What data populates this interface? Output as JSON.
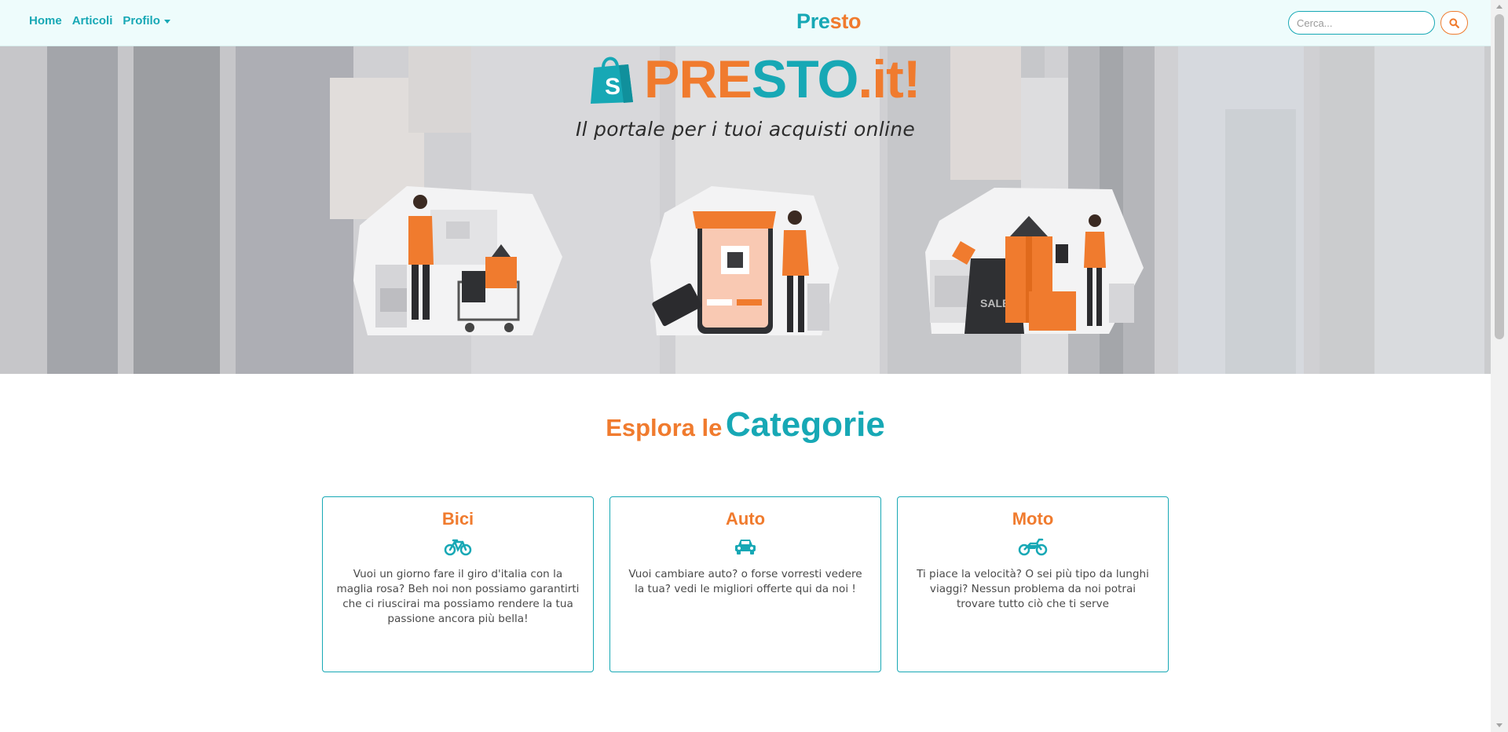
{
  "navbar": {
    "links": [
      "Home",
      "Articoli",
      "Profilo"
    ],
    "brand_part1": "Pre",
    "brand_part2": "sto",
    "search_placeholder": "Cerca..."
  },
  "hero": {
    "logo_part1": "PRE",
    "logo_part2": "STO",
    "logo_part3": ".it!",
    "logo_icon": "shopping-bag-icon",
    "subtitle": "Il portale per i tuoi acquisti online"
  },
  "categories": {
    "title_small": "Esplora le",
    "title_big": "Categorie",
    "cards": [
      {
        "title": "Bici",
        "icon": "bicycle-icon",
        "text": "Vuoi un giorno fare il giro d'italia con la maglia rosa? Beh noi non possiamo garantirti che ci riuscirai ma possiamo rendere la tua passione ancora più bella!"
      },
      {
        "title": "Auto",
        "icon": "car-icon",
        "text": "Vuoi cambiare auto? o forse vorresti vedere la tua? vedi le migliori offerte qui da noi !"
      },
      {
        "title": "Moto",
        "icon": "motorcycle-icon",
        "text": "Ti piace la velocità? O sei più tipo da lunghi viaggi? Nessun problema da noi potrai trovare tutto ciò che ti serve"
      }
    ]
  },
  "colors": {
    "teal": "#17a8b5",
    "orange": "#f07b2e"
  }
}
